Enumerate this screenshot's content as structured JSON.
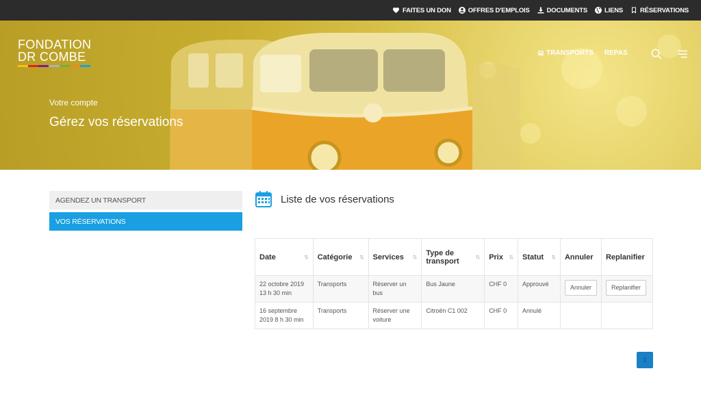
{
  "topnav": {
    "items": [
      {
        "label": "FAITES UN DON",
        "icon": "heart-icon"
      },
      {
        "label": "OFFRES D'EMPLOIS",
        "icon": "user-circle-icon"
      },
      {
        "label": "DOCUMENTS",
        "icon": "download-icon"
      },
      {
        "label": "LIENS",
        "icon": "globe-icon"
      },
      {
        "label": "RÉSERVATIONS",
        "icon": "bookmark-icon"
      }
    ]
  },
  "logo": {
    "line1": "FONDATION",
    "line2": "DR COMBE",
    "colors": [
      "#f2c21a",
      "#e2231a",
      "#7a1f8b",
      "#b0b0b0",
      "#6cb33f",
      "#f08a1c",
      "#1a9fe2"
    ]
  },
  "mainnav": {
    "items": [
      {
        "label": "TRANSPORTS",
        "icon": "bus-icon"
      },
      {
        "label": "REPAS"
      }
    ]
  },
  "hero": {
    "subtitle": "Votre compte",
    "title": "Gérez vos réservations"
  },
  "sidebar": {
    "items": [
      {
        "label": "AGENDEZ UN TRANSPORT"
      },
      {
        "label": "VOS RÉSERVATIONS",
        "active": true
      }
    ]
  },
  "section": {
    "title": "Liste de vos réservations",
    "icon": "calendar-icon"
  },
  "table": {
    "headers": [
      "Date",
      "Catégorie",
      "Services",
      "Type de transport",
      "Prix",
      "Statut",
      "Annuler",
      "Replanifier"
    ],
    "rows": [
      {
        "date": "22 octobre 2019 13 h 30 min",
        "category": "Transports",
        "service": "Réserver un bus",
        "type": "Bus Jaune",
        "price": "CHF 0",
        "status": "Approuvé",
        "cancel": "Annuler",
        "reschedule": "Replanifier"
      },
      {
        "date": "16 septembre 2019 8 h 30 min",
        "category": "Transports",
        "service": "Réserver une voiture",
        "type": "Citroën C1 002",
        "price": "CHF 0",
        "status": "Annulé",
        "cancel": "",
        "reschedule": ""
      }
    ]
  },
  "pagination": {
    "current": "1"
  },
  "colors": {
    "accent": "#1a9fe2",
    "topbar": "#2c2c2c",
    "hero": "#d4bb3d"
  }
}
